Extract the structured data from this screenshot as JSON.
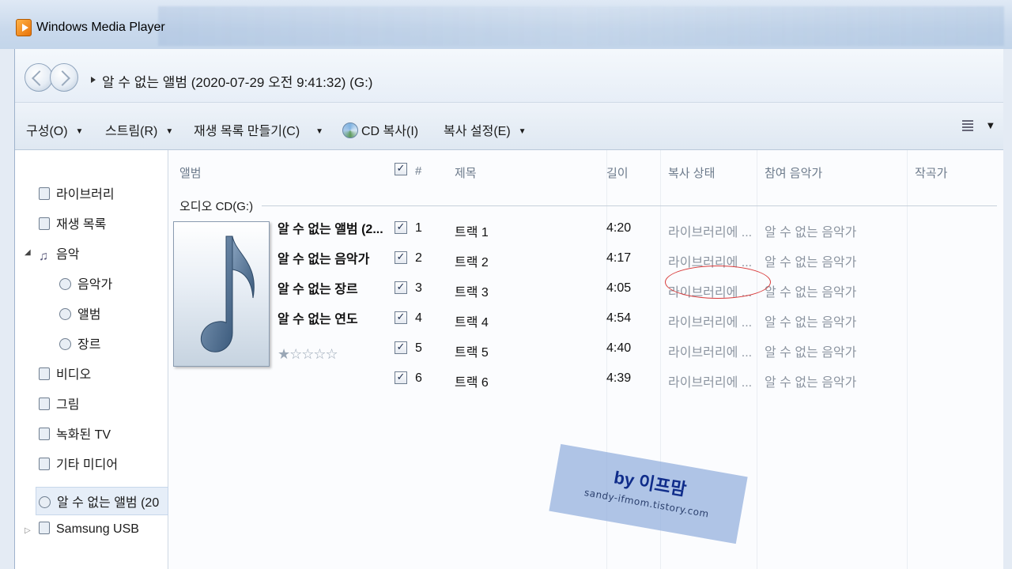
{
  "titlebar": {
    "app_name": "Windows Media Player"
  },
  "nav": {
    "breadcrumb": "알 수 없는 앨범 (2020-07-29 오전 9:41:32) (G:)"
  },
  "toolbar": {
    "organize": "구성(O)",
    "stream": "스트림(R)",
    "create_playlist": "재생 목록 만들기(C)",
    "rip_cd": "CD 복사(I)",
    "rip_settings": "복사 설정(E)"
  },
  "sidebar": {
    "library": "라이브러리",
    "playlists": "재생 목록",
    "music": "음악",
    "artist": "음악가",
    "album": "앨범",
    "genre": "장르",
    "videos": "비디오",
    "pictures": "그림",
    "recorded_tv": "녹화된 TV",
    "other_media": "기타 미디어",
    "cd_album": "알 수 없는 앨범 (20",
    "samsung_usb": "Samsung USB"
  },
  "columns": {
    "album": "앨범",
    "num": "#",
    "title": "제목",
    "length": "길이",
    "rip_status": "복사 상태",
    "contributing_artist": "참여 음악가",
    "composer": "작곡가"
  },
  "group": {
    "label": "오디오 CD(G:)",
    "album_title": "알 수 없는 앨범 (2...",
    "artist": "알 수 없는 음악가",
    "genre": "알 수 없는 장르",
    "year": "알 수 없는 연도",
    "rating_stars": "★☆☆☆☆"
  },
  "tracks": [
    {
      "checked": "✓",
      "num": "1",
      "title": "트랙 1",
      "length": "4:20",
      "status": "라이브러리에 ...",
      "artist": "알 수 없는 음악가"
    },
    {
      "checked": "✓",
      "num": "2",
      "title": "트랙 2",
      "length": "4:17",
      "status": "라이브러리에 ...",
      "artist": "알 수 없는 음악가"
    },
    {
      "checked": "✓",
      "num": "3",
      "title": "트랙 3",
      "length": "4:05",
      "status": "라이브러리에 ...",
      "artist": "알 수 없는 음악가"
    },
    {
      "checked": "✓",
      "num": "4",
      "title": "트랙 4",
      "length": "4:54",
      "status": "라이브러리에 ...",
      "artist": "알 수 없는 음악가"
    },
    {
      "checked": "✓",
      "num": "5",
      "title": "트랙 5",
      "length": "4:40",
      "status": "라이브러리에 ...",
      "artist": "알 수 없는 음악가"
    },
    {
      "checked": "✓",
      "num": "6",
      "title": "트랙 6",
      "length": "4:39",
      "status": "라이브러리에 ...",
      "artist": "알 수 없는 음악가"
    }
  ],
  "header_check": "✓",
  "watermark": {
    "title": "by 이프맘",
    "subtitle": "sandy-ifmom.tistory.com"
  },
  "colors": {
    "highlight_ellipse": "#d93a3a",
    "watermark_bg": "#91aedc",
    "watermark_text": "#0f2c8a"
  }
}
